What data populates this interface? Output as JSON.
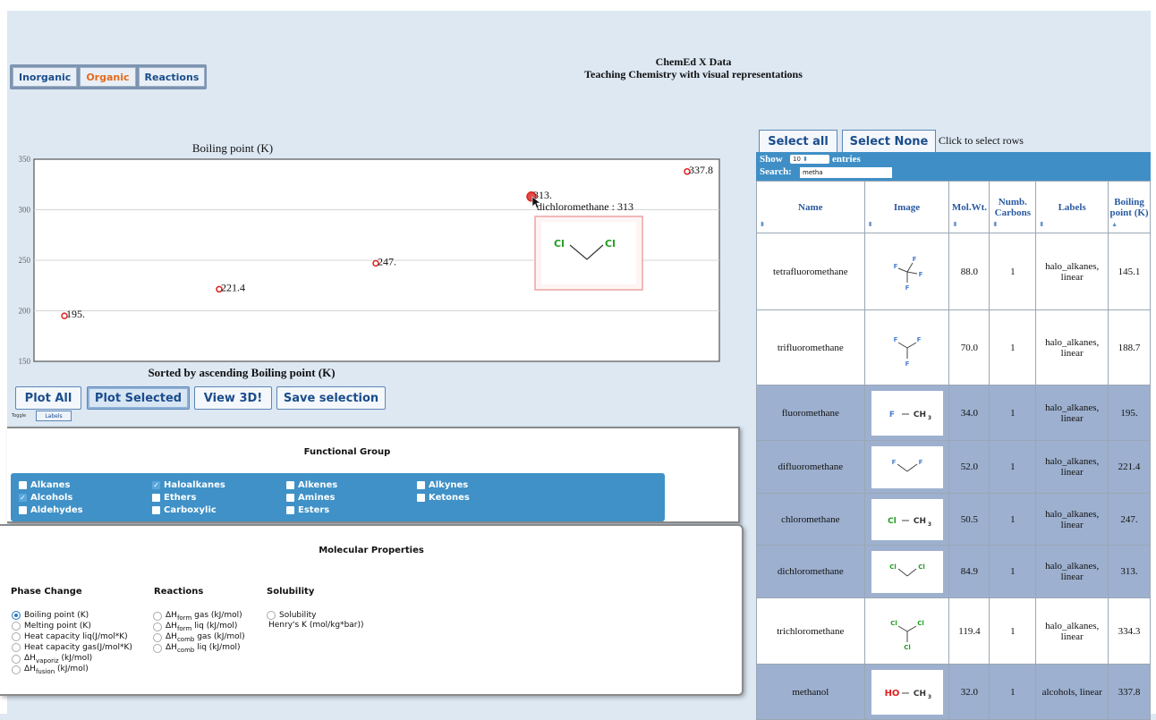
{
  "tabs": [
    {
      "label": "Inorganic"
    },
    {
      "label": "Organic"
    },
    {
      "label": "Reactions"
    }
  ],
  "header": {
    "title": "ChemEd X Data",
    "subtitle": "Teaching Chemistry with visual representations"
  },
  "chart_data": {
    "type": "scatter",
    "title": "Boiling point (K)",
    "xlabel": "Sorted by ascending Boiling point (K)",
    "ylabel": "",
    "ylim": [
      150,
      350
    ],
    "yticks": [
      150,
      200,
      250,
      300,
      350
    ],
    "grid": true,
    "points": [
      {
        "name": "fluoromethane",
        "y": 195,
        "label": "195."
      },
      {
        "name": "difluoromethane",
        "y": 221.4,
        "label": "221.4"
      },
      {
        "name": "chloromethane",
        "y": 247,
        "label": "247."
      },
      {
        "name": "dichloromethane",
        "y": 313,
        "label": "313."
      },
      {
        "name": "methanol",
        "y": 337.8,
        "label": "337.8"
      }
    ],
    "tooltip": {
      "text": "dichloromethane : 313",
      "atoms": [
        "Cl",
        "Cl"
      ]
    }
  },
  "plot_buttons": {
    "plot_all": "Plot All",
    "plot_selected": "Plot Selected",
    "view_3d": "View 3D!",
    "save_selection": "Save selection",
    "toggle": "Toggle",
    "labels": "Labels"
  },
  "functional_group": {
    "title": "Functional Group",
    "items": [
      {
        "label": "Alkanes",
        "checked": false
      },
      {
        "label": "Haloalkanes",
        "checked": true
      },
      {
        "label": "Alkenes",
        "checked": false
      },
      {
        "label": "Alkynes",
        "checked": false
      },
      {
        "label": "Alcohols",
        "checked": true
      },
      {
        "label": "Ethers",
        "checked": false
      },
      {
        "label": "Amines",
        "checked": false
      },
      {
        "label": "Ketones",
        "checked": false
      },
      {
        "label": "Aldehydes",
        "checked": false
      },
      {
        "label": "Carboxylic",
        "checked": false
      },
      {
        "label": "Esters",
        "checked": false
      }
    ]
  },
  "molecular_properties": {
    "title": "Molecular Properties",
    "phase_change": {
      "heading": "Phase Change",
      "options": [
        {
          "label": "Boiling point (K)",
          "selected": true
        },
        {
          "label": "Melting point (K)",
          "selected": false
        },
        {
          "label": "Heat capacity liq(J/mol*K)",
          "selected": false
        },
        {
          "label": "Heat capacity gas(J/mol*K)",
          "selected": false
        },
        {
          "prefix": "ΔH",
          "sub": "vaporiz",
          "suffix": " (kJ/mol)",
          "selected": false
        },
        {
          "prefix": "ΔH",
          "sub": "fusion",
          "suffix": " (kJ/mol)",
          "selected": false
        }
      ]
    },
    "reactions": {
      "heading": "Reactions",
      "options": [
        {
          "prefix": "ΔH",
          "sub": "form",
          "suffix": " gas (kJ/mol)",
          "selected": false
        },
        {
          "prefix": "ΔH",
          "sub": "form",
          "suffix": " liq (kJ/mol)",
          "selected": false
        },
        {
          "prefix": "ΔH",
          "sub": "comb",
          "suffix": " gas (kJ/mol)",
          "selected": false
        },
        {
          "prefix": "ΔH",
          "sub": "comb",
          "suffix": " liq (kJ/mol)",
          "selected": false
        }
      ]
    },
    "solubility": {
      "heading": "Solubility",
      "options": [
        {
          "label": "Solubility",
          "selected": false
        }
      ],
      "extra": "Henry's K (mol/kg*bar))"
    }
  },
  "table_controls": {
    "select_all": "Select all",
    "select_none": "Select None",
    "hint": "Click to select rows",
    "show": "Show",
    "entries_value": "10",
    "entries": "entries",
    "search_label": "Search:",
    "search_value": "metha"
  },
  "table": {
    "columns": [
      "Name",
      "Image",
      "Mol.Wt.",
      "Numb. Carbons",
      "Labels",
      "Boiling point (K)"
    ],
    "rows": [
      {
        "name": "tetrafluoromethane",
        "molwt": "88.0",
        "carbons": "1",
        "labels": "halo_alkanes, linear",
        "bp": "145.1",
        "selected": false,
        "img": "cf4"
      },
      {
        "name": "trifluoromethane",
        "molwt": "70.0",
        "carbons": "1",
        "labels": "halo_alkanes, linear",
        "bp": "188.7",
        "selected": false,
        "img": "chf3"
      },
      {
        "name": "fluoromethane",
        "molwt": "34.0",
        "carbons": "1",
        "labels": "halo_alkanes, linear",
        "bp": "195.",
        "selected": true,
        "img": "ch3f",
        "img_text": "F",
        "img_ch3": "CH"
      },
      {
        "name": "difluoromethane",
        "molwt": "52.0",
        "carbons": "1",
        "labels": "halo_alkanes, linear",
        "bp": "221.4",
        "selected": true,
        "img": "ch2f2"
      },
      {
        "name": "chloromethane",
        "molwt": "50.5",
        "carbons": "1",
        "labels": "halo_alkanes, linear",
        "bp": "247.",
        "selected": true,
        "img": "ch3cl",
        "img_text": "Cl",
        "img_ch3": "CH"
      },
      {
        "name": "dichloromethane",
        "molwt": "84.9",
        "carbons": "1",
        "labels": "halo_alkanes, linear",
        "bp": "313.",
        "selected": true,
        "img": "ch2cl2"
      },
      {
        "name": "trichloromethane",
        "molwt": "119.4",
        "carbons": "1",
        "labels": "halo_alkanes, linear",
        "bp": "334.3",
        "selected": false,
        "img": "chcl3"
      },
      {
        "name": "methanol",
        "molwt": "32.0",
        "carbons": "1",
        "labels": "alcohols, linear",
        "bp": "337.8",
        "selected": true,
        "img": "ch3oh",
        "img_text": "HO",
        "img_ch3": "CH"
      }
    ]
  }
}
